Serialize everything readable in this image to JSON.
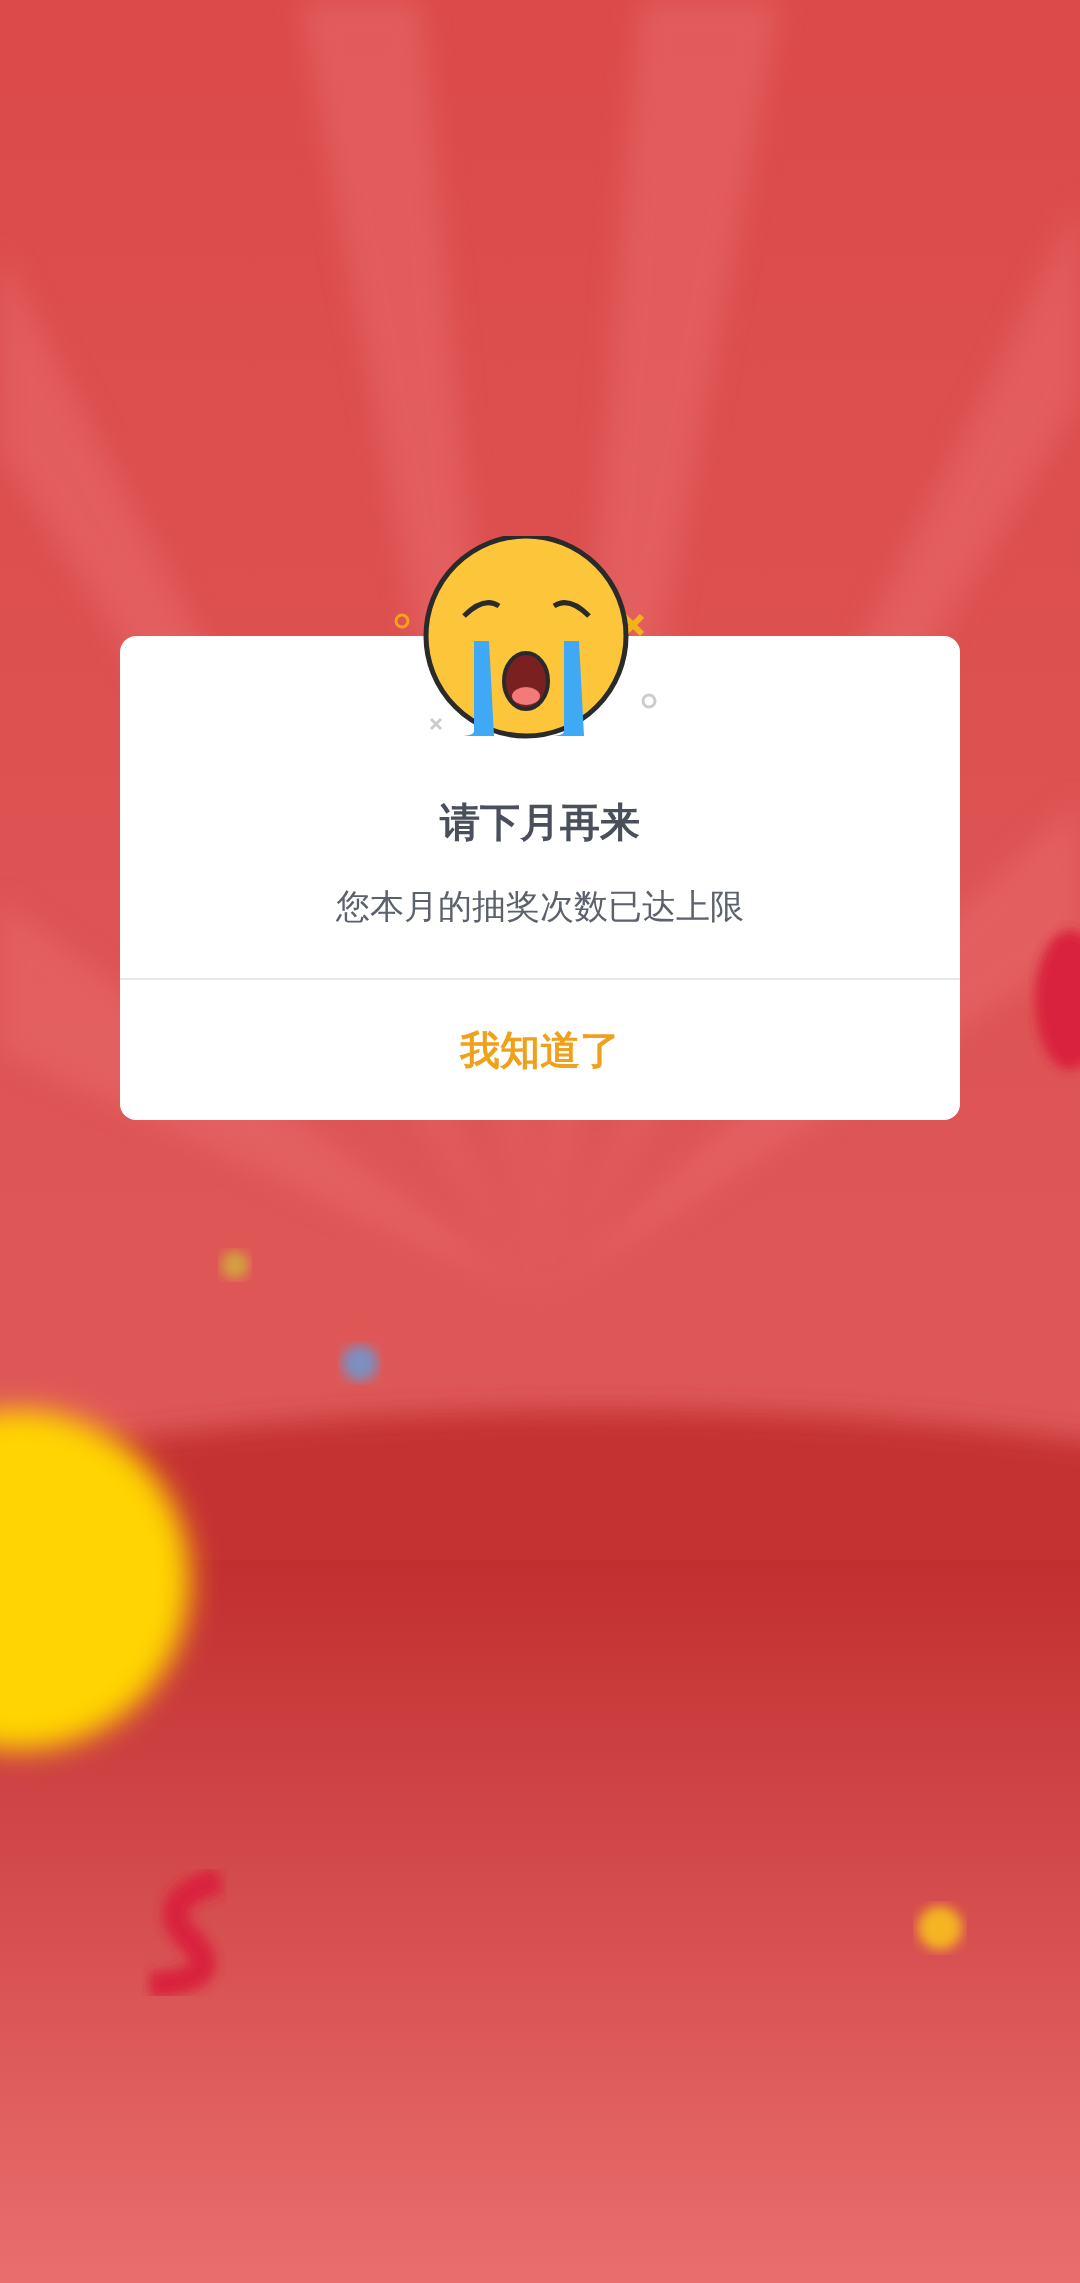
{
  "dialog": {
    "title": "请下月再来",
    "message": "您本月的抽奖次数已达上限",
    "button": "我知道了"
  }
}
